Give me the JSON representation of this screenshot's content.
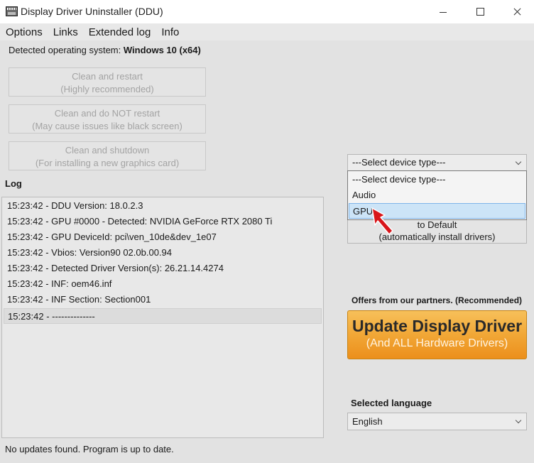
{
  "window": {
    "title": "Display Driver Uninstaller (DDU)"
  },
  "menu": [
    "Options",
    "Links",
    "Extended log",
    "Info"
  ],
  "os": {
    "label": "Detected operating system:",
    "value": "Windows 10 (x64)"
  },
  "buttons": {
    "clean_restart": {
      "line1": "Clean and restart",
      "line2": "(Highly recommended)"
    },
    "clean_no_restart": {
      "line1": "Clean and do NOT restart",
      "line2": "(May cause issues like black screen)"
    },
    "clean_shutdown": {
      "line1": "Clean and shutdown",
      "line2": "(For installing a new graphics card)"
    }
  },
  "log": {
    "label": "Log",
    "entries": [
      "15:23:42 - DDU Version: 18.0.2.3",
      "15:23:42 - GPU #0000 - Detected: NVIDIA GeForce RTX 2080 Ti",
      "15:23:42 - GPU DeviceId: pci\\ven_10de&dev_1e07",
      "15:23:42 - Vbios: Version90 02.0b.00.94",
      "15:23:42 - Detected Driver Version(s): 26.21.14.4274",
      "15:23:42 - INF: oem46.inf",
      "15:23:42 - INF Section: Section001",
      "15:23:42 - --------------"
    ],
    "selected_index": 7
  },
  "status": "No updates found. Program is up to date.",
  "device_type": {
    "selected": "---Select device type---",
    "options": [
      "---Select device type---",
      "Audio",
      "GPU"
    ],
    "highlighted": "GPU"
  },
  "default_button": {
    "line1": "to Default",
    "line2": "(automatically install drivers)"
  },
  "partners": {
    "label": "Offers from our partners. (Recommended)",
    "main": "Update Display Driver",
    "sub": "(And ALL Hardware Drivers)"
  },
  "language": {
    "label": "Selected language",
    "value": "English"
  },
  "colors": {
    "highlight": "#cce4f7",
    "offer_orange": "#f1a736",
    "cursor_red": "#d8161b"
  }
}
